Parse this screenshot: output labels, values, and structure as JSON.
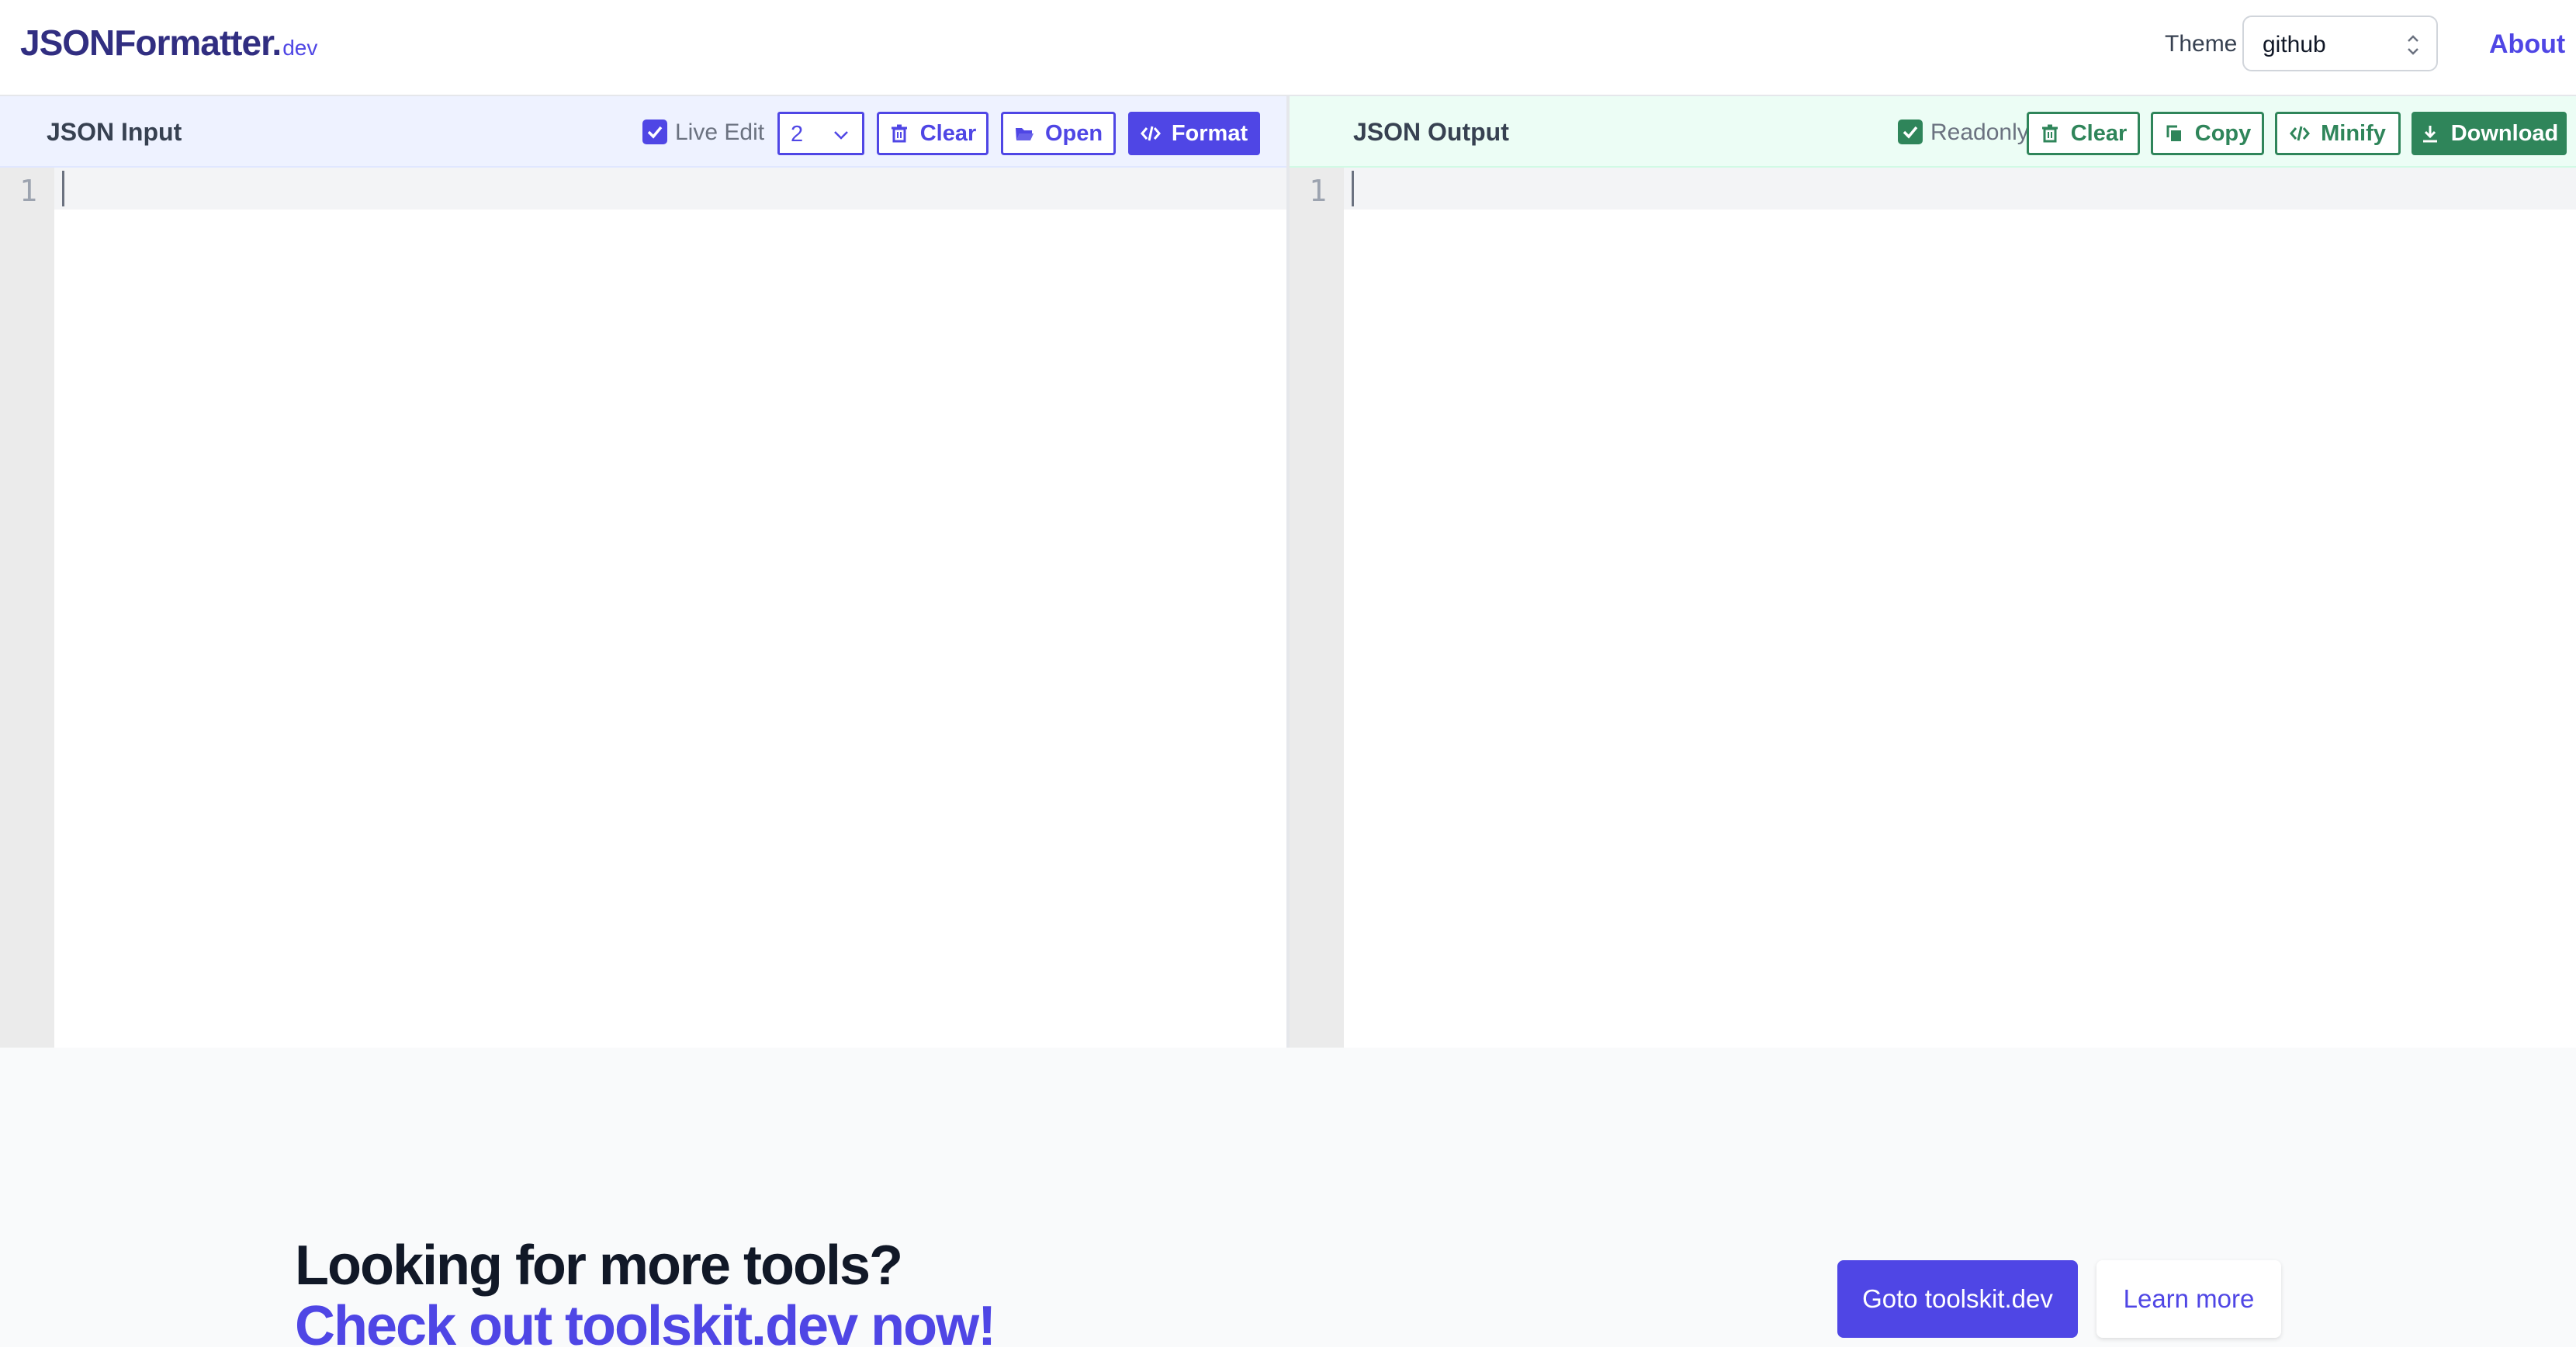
{
  "header": {
    "logo_main": "JSONFormatter.",
    "logo_dev": "dev",
    "theme_label": "Theme",
    "theme_value": "github",
    "about_label": "About"
  },
  "input_pane": {
    "title": "JSON Input",
    "live_edit_label": "Live Edit",
    "live_edit_checked": true,
    "indent_value": "2",
    "clear_label": "Clear",
    "open_label": "Open",
    "format_label": "Format",
    "line_numbers": [
      "1"
    ]
  },
  "output_pane": {
    "title": "JSON Output",
    "readonly_label": "Readonly",
    "readonly_checked": true,
    "clear_label": "Clear",
    "copy_label": "Copy",
    "minify_label": "Minify",
    "download_label": "Download",
    "line_numbers": [
      "1"
    ]
  },
  "footer": {
    "headline": "Looking for more tools?",
    "subheadline": "Check out toolskit.dev now!",
    "goto_label": "Goto toolskit.dev",
    "learn_more_label": "Learn more"
  },
  "colors": {
    "brand": "#4f46e5",
    "brand_dark": "#312e81",
    "output_accent": "#2f855a",
    "input_bar_bg": "#eef2ff",
    "output_bar_bg": "#ecfdf5"
  }
}
